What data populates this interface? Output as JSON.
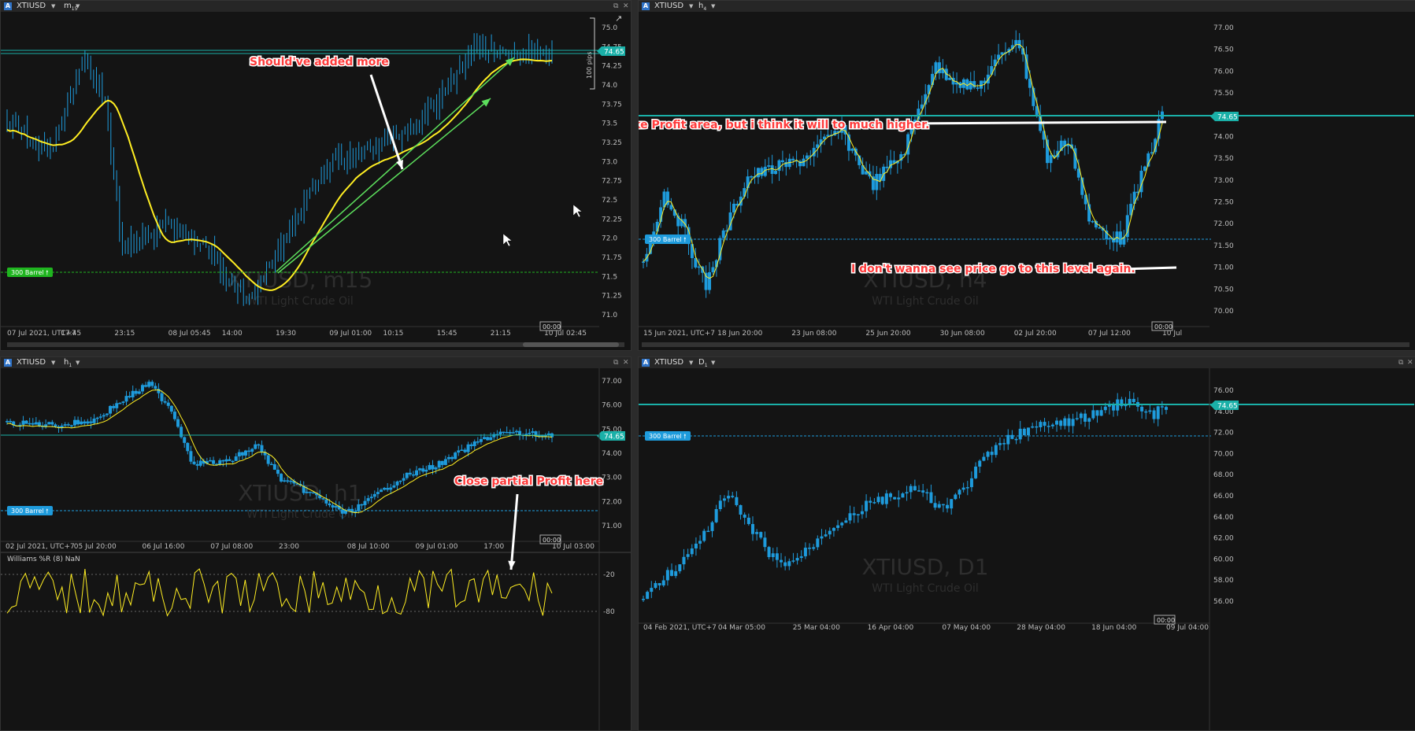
{
  "colors": {
    "bg": "#141414",
    "candle": "#1e9bdc",
    "ma": "#ffee22",
    "price": "#1ab0a8",
    "green": "#1fb51f",
    "note": "#ff3b3b"
  },
  "panels": {
    "tl": {
      "symbol": "XTIUSD",
      "tf": "m",
      "tf_sub": "15",
      "watermark": "XTIUSD, m15",
      "sub": "WTI Light Crude Oil",
      "price_tag": "74.65",
      "barrel_label": "300 Barrel",
      "pips_label": "100 pips",
      "timer": "00:00",
      "yticks": [
        "75.0",
        "74.75",
        "74.25",
        "74.0",
        "73.75",
        "73.5",
        "73.25",
        "73.0",
        "72.75",
        "72.5",
        "72.25",
        "72.0",
        "71.75",
        "71.5",
        "71.25",
        "71.0"
      ],
      "xticks": [
        "07 Jul 2021, UTC+7",
        "17:45",
        "23:15",
        "08 Jul 05:45",
        "14:00",
        "19:30",
        "09 Jul 01:00",
        "10:15",
        "15:45",
        "21:15",
        "10 Jul 02:45"
      ],
      "note": "Should've added more"
    },
    "tr": {
      "symbol": "XTIUSD",
      "tf": "h",
      "tf_sub": "4",
      "watermark": "XTIUSD, h4",
      "sub": "WTI Light Crude Oil",
      "price_tag": "74.65",
      "barrel_label": "300 Barrel",
      "timer": "00:00",
      "yticks": [
        "77.00",
        "76.50",
        "76.00",
        "75.50",
        "75.00",
        "74.00",
        "73.50",
        "73.00",
        "72.50",
        "72.00",
        "71.50",
        "71.00",
        "70.50",
        "70.00"
      ],
      "xticks": [
        "15 Jun 2021, UTC+7",
        "18 Jun 20:00",
        "23 Jun 08:00",
        "25 Jun 20:00",
        "30 Jun 08:00",
        "02 Jul 20:00",
        "07 Jul 12:00",
        "10 Jul"
      ],
      "note1": "Take Profit area, but i think it will to much higher.",
      "note2": "I don't wanna see price go to this level again."
    },
    "bl": {
      "symbol": "XTIUSD",
      "tf": "h",
      "tf_sub": "1",
      "watermark": "XTIUSD, h1",
      "sub": "WTI Light Crude Oil",
      "price_tag": "74.65",
      "barrel_label": "300 Barrel",
      "timer": "00:00",
      "yticks": [
        "77.00",
        "76.00",
        "75.00",
        "74.00",
        "73.00",
        "72.00",
        "71.00"
      ],
      "xticks": [
        "02 Jul 2021, UTC+7",
        "05 Jul 20:00",
        "06 Jul 16:00",
        "07 Jul 08:00",
        "23:00",
        "08 Jul 10:00",
        "09 Jul 01:00",
        "17:00",
        "10 Jul 03:00"
      ],
      "note": "Close partial Profit here",
      "indicator": {
        "label": "Williams %R (8) NaN",
        "levels": [
          "-20",
          "-80"
        ]
      }
    },
    "br": {
      "symbol": "XTIUSD",
      "tf": "D",
      "tf_sub": "1",
      "watermark": "XTIUSD, D1",
      "sub": "WTI Light Crude Oil",
      "price_tag": "74.65",
      "barrel_label": "300 Barrel",
      "timer": "00:00",
      "yticks": [
        "76.00",
        "74.00",
        "72.00",
        "70.00",
        "68.00",
        "66.00",
        "64.00",
        "62.00",
        "60.00",
        "58.00",
        "56.00"
      ],
      "xticks": [
        "04 Feb 2021, UTC+7",
        "04 Mar 05:00",
        "25 Mar 04:00",
        "16 Apr 04:00",
        "07 May 04:00",
        "28 May 04:00",
        "18 Jun 04:00",
        "09 Jul 04:00"
      ]
    }
  }
}
